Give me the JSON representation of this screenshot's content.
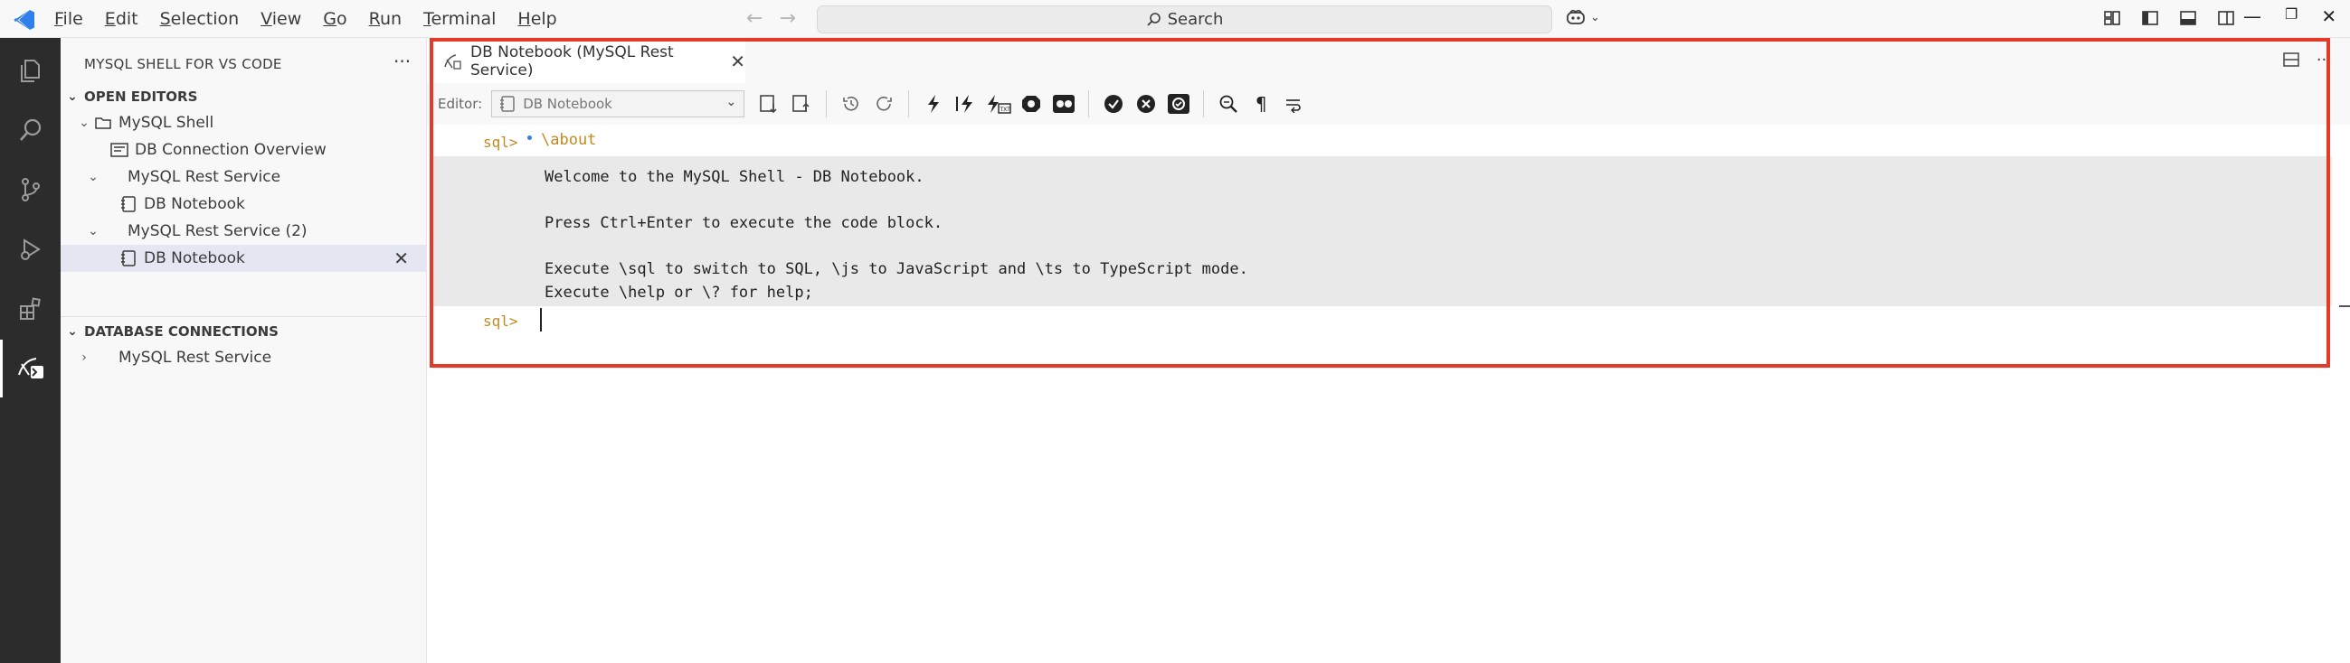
{
  "titlebar": {
    "menu": [
      {
        "label": "File",
        "u": "F",
        "rest": "ile"
      },
      {
        "label": "Edit",
        "u": "E",
        "rest": "dit"
      },
      {
        "label": "Selection",
        "u": "S",
        "rest": "election"
      },
      {
        "label": "View",
        "u": "V",
        "rest": "iew"
      },
      {
        "label": "Go",
        "u": "G",
        "rest": "o"
      },
      {
        "label": "Run",
        "u": "R",
        "rest": "un"
      },
      {
        "label": "Terminal",
        "u": "T",
        "rest": "erminal"
      },
      {
        "label": "Help",
        "u": "H",
        "rest": "elp"
      }
    ],
    "search_label": "Search"
  },
  "sidebar": {
    "title": "MYSQL SHELL FOR VS CODE",
    "open_editors": {
      "header": "OPEN EDITORS",
      "items": [
        {
          "label": "MySQL Shell"
        },
        {
          "label": "DB Connection Overview"
        },
        {
          "label": "MySQL Rest Service"
        },
        {
          "label": "DB Notebook"
        },
        {
          "label": "MySQL Rest Service (2)"
        },
        {
          "label": "DB Notebook"
        }
      ]
    },
    "db_connections": {
      "header": "DATABASE CONNECTIONS",
      "items": [
        {
          "label": "MySQL Rest Service"
        }
      ]
    }
  },
  "editor": {
    "tab_label": "DB Notebook (MySQL Rest Service)",
    "toolbar": {
      "editor_label": "Editor:",
      "editor_value": "DB Notebook"
    },
    "prompt": "sql>",
    "command": "\\about",
    "output_lines": [
      "Welcome to the MySQL Shell - DB Notebook.",
      "Press Ctrl+Enter to execute the code block.",
      "Execute \\sql to switch to SQL, \\js to JavaScript and \\ts to TypeScript mode.",
      "Execute \\help or \\? for help;"
    ],
    "next_prompt": "sql>"
  },
  "colors": {
    "accent_frame": "#e23b2a",
    "activity_bar": "#2c2c2c",
    "prompt_color": "#c08a1f",
    "vscode_blue": "#2f80ed"
  }
}
